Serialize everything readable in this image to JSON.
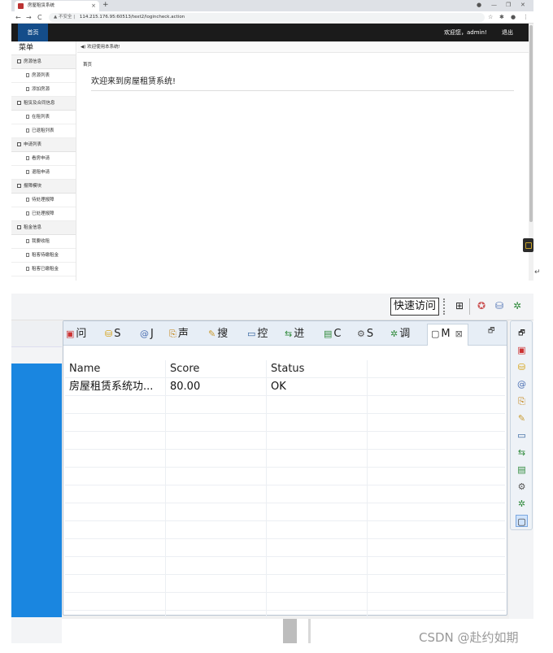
{
  "browser": {
    "tab_title": "房屋租赁系统",
    "tab_close": "×",
    "new_tab": "+",
    "window_controls": [
      "●",
      "—",
      "❐",
      "✕"
    ],
    "nav": {
      "back": "←",
      "forward": "→",
      "reload": "C"
    },
    "address": {
      "security": "▲ 不安全 |",
      "url": "114.215.176.95:60513/text2/logincheck.action"
    },
    "toolbar_icons": [
      "☆",
      "✱",
      "●",
      "⋮"
    ]
  },
  "app": {
    "header": {
      "home_tab": "首页",
      "welcome_user": "欢迎您，admin!",
      "logout": "退出"
    },
    "sidebar": {
      "title": "菜单",
      "groups": [
        {
          "label": "房源信息",
          "items": [
            "房源列表",
            "添加房源"
          ]
        },
        {
          "label": "租赁及合同信息",
          "items": [
            "在租列表",
            "已退租列表"
          ]
        },
        {
          "label": "申请列表",
          "items": [
            "看房申请",
            "退租申请"
          ]
        },
        {
          "label": "报障模块",
          "items": [
            "待处理报障",
            "已处理报障"
          ]
        },
        {
          "label": "租金信息",
          "items": [
            "我要收租",
            "租客待缴租金",
            "租客已缴租金"
          ]
        }
      ]
    },
    "notice": "◀) 欢迎使用本系统!",
    "breadcrumb": "首页",
    "hero": "欢迎来到房屋租赁系统!"
  },
  "ide": {
    "quick_access": "快速访问",
    "perspective_icons": [
      "⊞",
      "✪",
      "⛁",
      "✲"
    ],
    "view_tabs": [
      {
        "icon": "▣",
        "label": "问"
      },
      {
        "icon": "⛁",
        "label": "S"
      },
      {
        "icon": "@",
        "label": "J"
      },
      {
        "icon": "⎘",
        "label": "声"
      },
      {
        "icon": "✎",
        "label": "搜"
      },
      {
        "icon": "▭",
        "label": "控"
      },
      {
        "icon": "⇆",
        "label": "进"
      },
      {
        "icon": "▤",
        "label": "C"
      },
      {
        "icon": "⚙",
        "label": "S"
      },
      {
        "icon": "✲",
        "label": "调"
      },
      {
        "icon": "▢",
        "label": "M"
      }
    ],
    "active_tab_close": "⊠",
    "maximize": "🗗",
    "table": {
      "headers": [
        "Name",
        "Score",
        "Status",
        ""
      ],
      "rows": [
        [
          "房屋租赁系统功...",
          "80.00",
          "OK",
          ""
        ]
      ],
      "empty_rows": 13
    },
    "right_icons": [
      "🗗",
      "▣",
      "⛁",
      "@",
      "⎘",
      "✎",
      "▭",
      "⇆",
      "▤",
      "⚙",
      "✲",
      "▢"
    ]
  },
  "watermark": "CSDN @赴约如期"
}
